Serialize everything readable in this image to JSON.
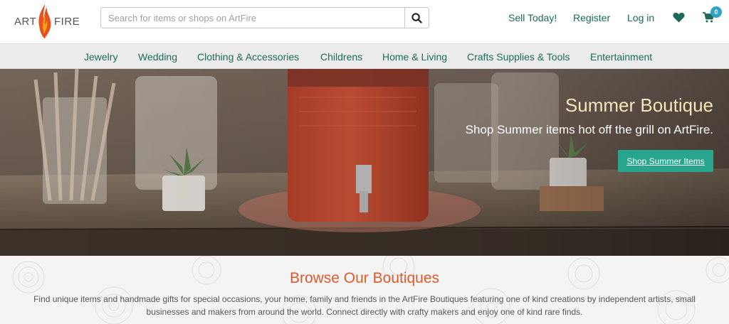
{
  "brand": {
    "logo_left": "ART",
    "logo_right": "FIRE",
    "flame_colors": [
      "#f6a21b",
      "#e8501f"
    ]
  },
  "search": {
    "placeholder": "Search for items or shops on ArtFire",
    "value": "",
    "icon": "search-icon"
  },
  "header_links": {
    "sell": "Sell Today!",
    "register": "Register",
    "login": "Log in",
    "favorites_icon": "heart-icon",
    "cart_icon": "cart-icon",
    "cart_count": "0"
  },
  "nav": {
    "items": [
      "Jewelry",
      "Wedding",
      "Clothing & Accessories",
      "Childrens",
      "Home & Living",
      "Crafts Supplies & Tools",
      "Entertainment"
    ]
  },
  "hero": {
    "title": "Summer Boutique",
    "subtitle": "Shop Summer items hot off the grill on ArtFire.",
    "cta": "Shop Summer Items"
  },
  "boutiques": {
    "title": "Browse Our Boutiques",
    "description": "Find unique items and handmade gifts for special occasions, your home, family and friends in the ArtFire Boutiques featuring one of kind creations by independent artists, small businesses and makers from around the world. Connect directly with crafty makers and enjoy one of kind rare finds."
  },
  "colors": {
    "link": "#1e6a5a",
    "accent": "#27a58d",
    "badge": "#2ea3c4",
    "heading": "#e05a2b",
    "hero_title": "#f6e6b8"
  }
}
